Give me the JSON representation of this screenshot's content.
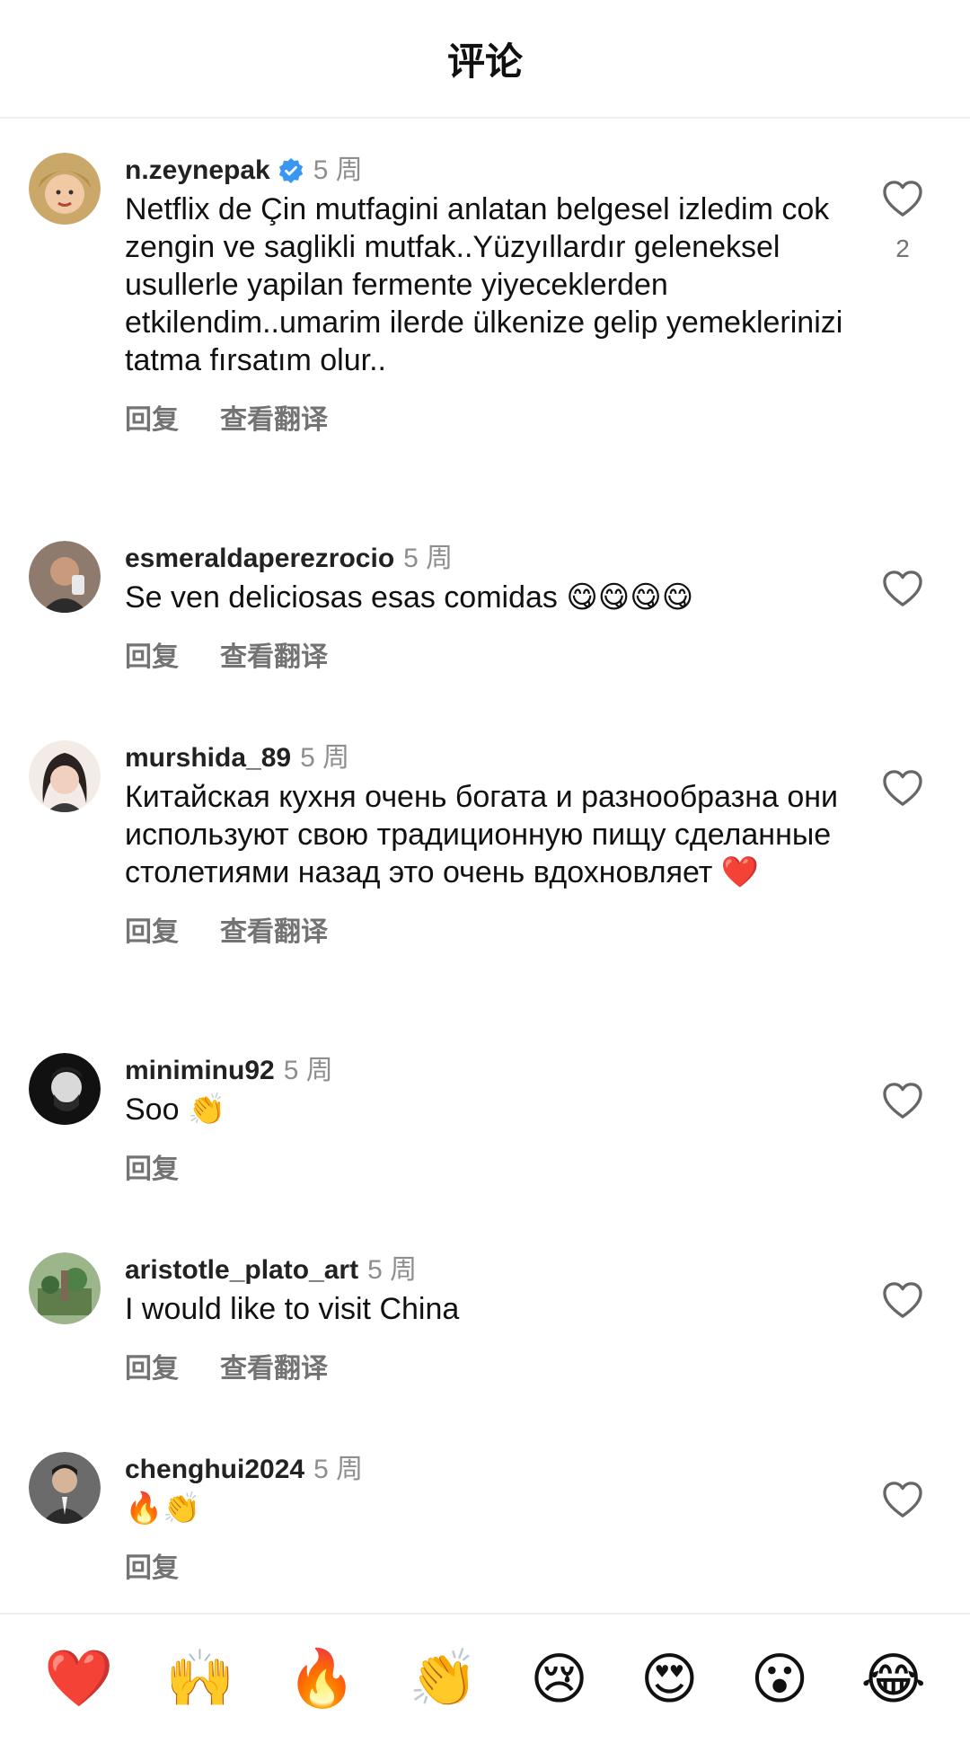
{
  "header": {
    "title": "评论"
  },
  "comments": [
    {
      "username": "n.zeynepak",
      "verified": true,
      "time": "5 周",
      "text": "Netflix de Çin mutfagini anlatan belgesel izledim cok zengin ve saglikli mutfak..Yüzyıllardır geleneksel usullerle yapilan fermente yiyeceklerden etkilendim..umarim ilerde ülkenize gelip yemeklerinizi tatma fırsatım olur..",
      "reply": "回复",
      "translate": "查看翻译",
      "likes": "2"
    },
    {
      "username": "esmeraldaperezrocio",
      "time": "5 周",
      "text": "Se ven deliciosas esas comidas 😋😋😋😋",
      "reply": "回复",
      "translate": "查看翻译"
    },
    {
      "username": "murshida_89",
      "time": "5 周",
      "text": "Китайская кухня очень богата и разнообразна  они  используют свою традиционную  пищу сделанные столетиями назад это очень вдохновляет ❤️",
      "reply": "回复",
      "translate": "查看翻译"
    },
    {
      "username": "miniminu92",
      "time": "5 周",
      "text": "Soo 👏",
      "reply": "回复"
    },
    {
      "username": "aristotle_plato_art",
      "time": "5 周",
      "text": "I would like to visit China",
      "reply": "回复",
      "translate": "查看翻译"
    },
    {
      "username": "chenghui2024",
      "time": "5 周",
      "text": "🔥👏",
      "reply": "回复"
    }
  ],
  "reactions": [
    "❤️",
    "🙌",
    "🔥",
    "👏",
    "😢",
    "😍",
    "😮",
    "😂"
  ],
  "colors": {
    "verified": "#3897f0",
    "muted": "#737373",
    "time": "#8e8e8e"
  }
}
